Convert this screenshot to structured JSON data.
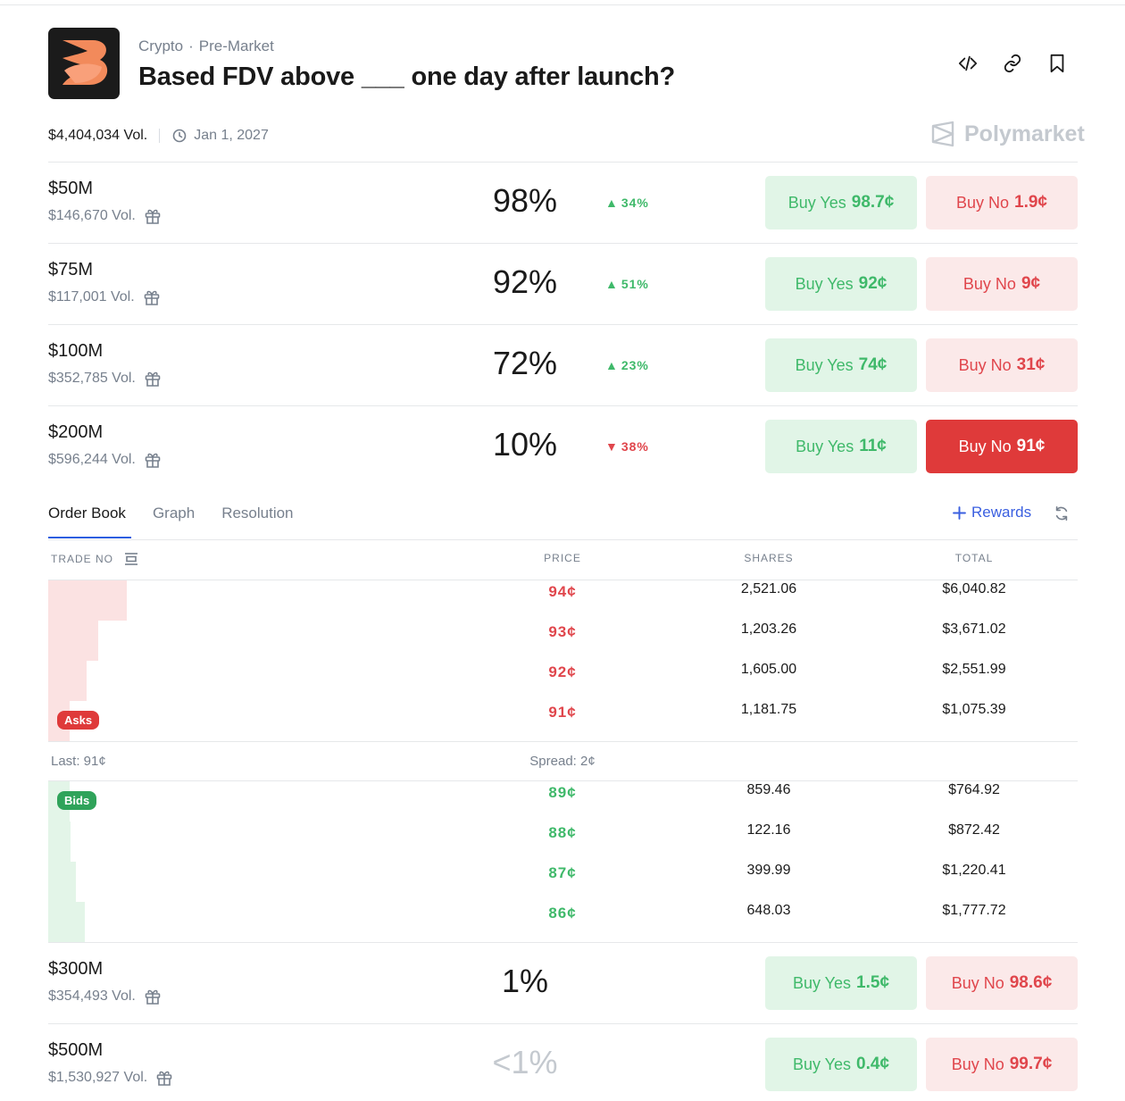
{
  "header": {
    "breadcrumb": [
      "Crypto",
      "Pre-Market"
    ],
    "title": "Based FDV above ___ one day after launch?",
    "volume": "$4,404,034 Vol.",
    "end_date": "Jan 1, 2027",
    "brand": "Polymarket",
    "actions": [
      "embed-icon",
      "link-icon",
      "bookmark-icon"
    ]
  },
  "markets": [
    {
      "label": "$50M",
      "volume": "$146,670 Vol.",
      "pct": "98%",
      "change": "34%",
      "dir": "up",
      "yes_label": "Buy Yes",
      "yes_price": "98.7¢",
      "no_label": "Buy No",
      "no_price": "1.9¢"
    },
    {
      "label": "$75M",
      "volume": "$117,001 Vol.",
      "pct": "92%",
      "change": "51%",
      "dir": "up",
      "yes_label": "Buy Yes",
      "yes_price": "92¢",
      "no_label": "Buy No",
      "no_price": "9¢"
    },
    {
      "label": "$100M",
      "volume": "$352,785 Vol.",
      "pct": "72%",
      "change": "23%",
      "dir": "up",
      "yes_label": "Buy Yes",
      "yes_price": "74¢",
      "no_label": "Buy No",
      "no_price": "31¢"
    },
    {
      "label": "$200M",
      "volume": "$596,244 Vol.",
      "pct": "10%",
      "change": "38%",
      "dir": "down",
      "yes_label": "Buy Yes",
      "yes_price": "11¢",
      "no_label": "Buy No",
      "no_price": "91¢",
      "selected": "no"
    },
    {
      "label": "$300M",
      "volume": "$354,493 Vol.",
      "pct": "1%",
      "yes_label": "Buy Yes",
      "yes_price": "1.5¢",
      "no_label": "Buy No",
      "no_price": "98.6¢"
    },
    {
      "label": "$500M",
      "volume": "$1,530,927 Vol.",
      "pct": "<1%",
      "yes_label": "Buy Yes",
      "yes_price": "0.4¢",
      "no_label": "Buy No",
      "no_price": "99.7¢"
    }
  ],
  "tabs": {
    "items": [
      "Order Book",
      "Graph",
      "Resolution"
    ],
    "active": "Order Book",
    "rewards": "Rewards"
  },
  "order_book": {
    "columns": {
      "side": "TRADE NO",
      "price": "PRICE",
      "shares": "SHARES",
      "total": "TOTAL"
    },
    "asks_tag": "Asks",
    "bids_tag": "Bids",
    "asks": [
      {
        "price": "94¢",
        "shares": "2,521.06",
        "total": "$6,040.82"
      },
      {
        "price": "93¢",
        "shares": "1,203.26",
        "total": "$3,671.02"
      },
      {
        "price": "92¢",
        "shares": "1,605.00",
        "total": "$2,551.99"
      },
      {
        "price": "91¢",
        "shares": "1,181.75",
        "total": "$1,075.39"
      }
    ],
    "last": "Last: 91¢",
    "spread": "Spread: 2¢",
    "bids": [
      {
        "price": "89¢",
        "shares": "859.46",
        "total": "$764.92"
      },
      {
        "price": "88¢",
        "shares": "122.16",
        "total": "$872.42"
      },
      {
        "price": "87¢",
        "shares": "399.99",
        "total": "$1,220.41"
      },
      {
        "price": "86¢",
        "shares": "648.03",
        "total": "$1,777.72"
      }
    ]
  },
  "colors": {
    "yes": "#3fb96a",
    "no": "#e0464c",
    "accent": "#2c5ee0",
    "logo_orange": "#f28a5b"
  }
}
